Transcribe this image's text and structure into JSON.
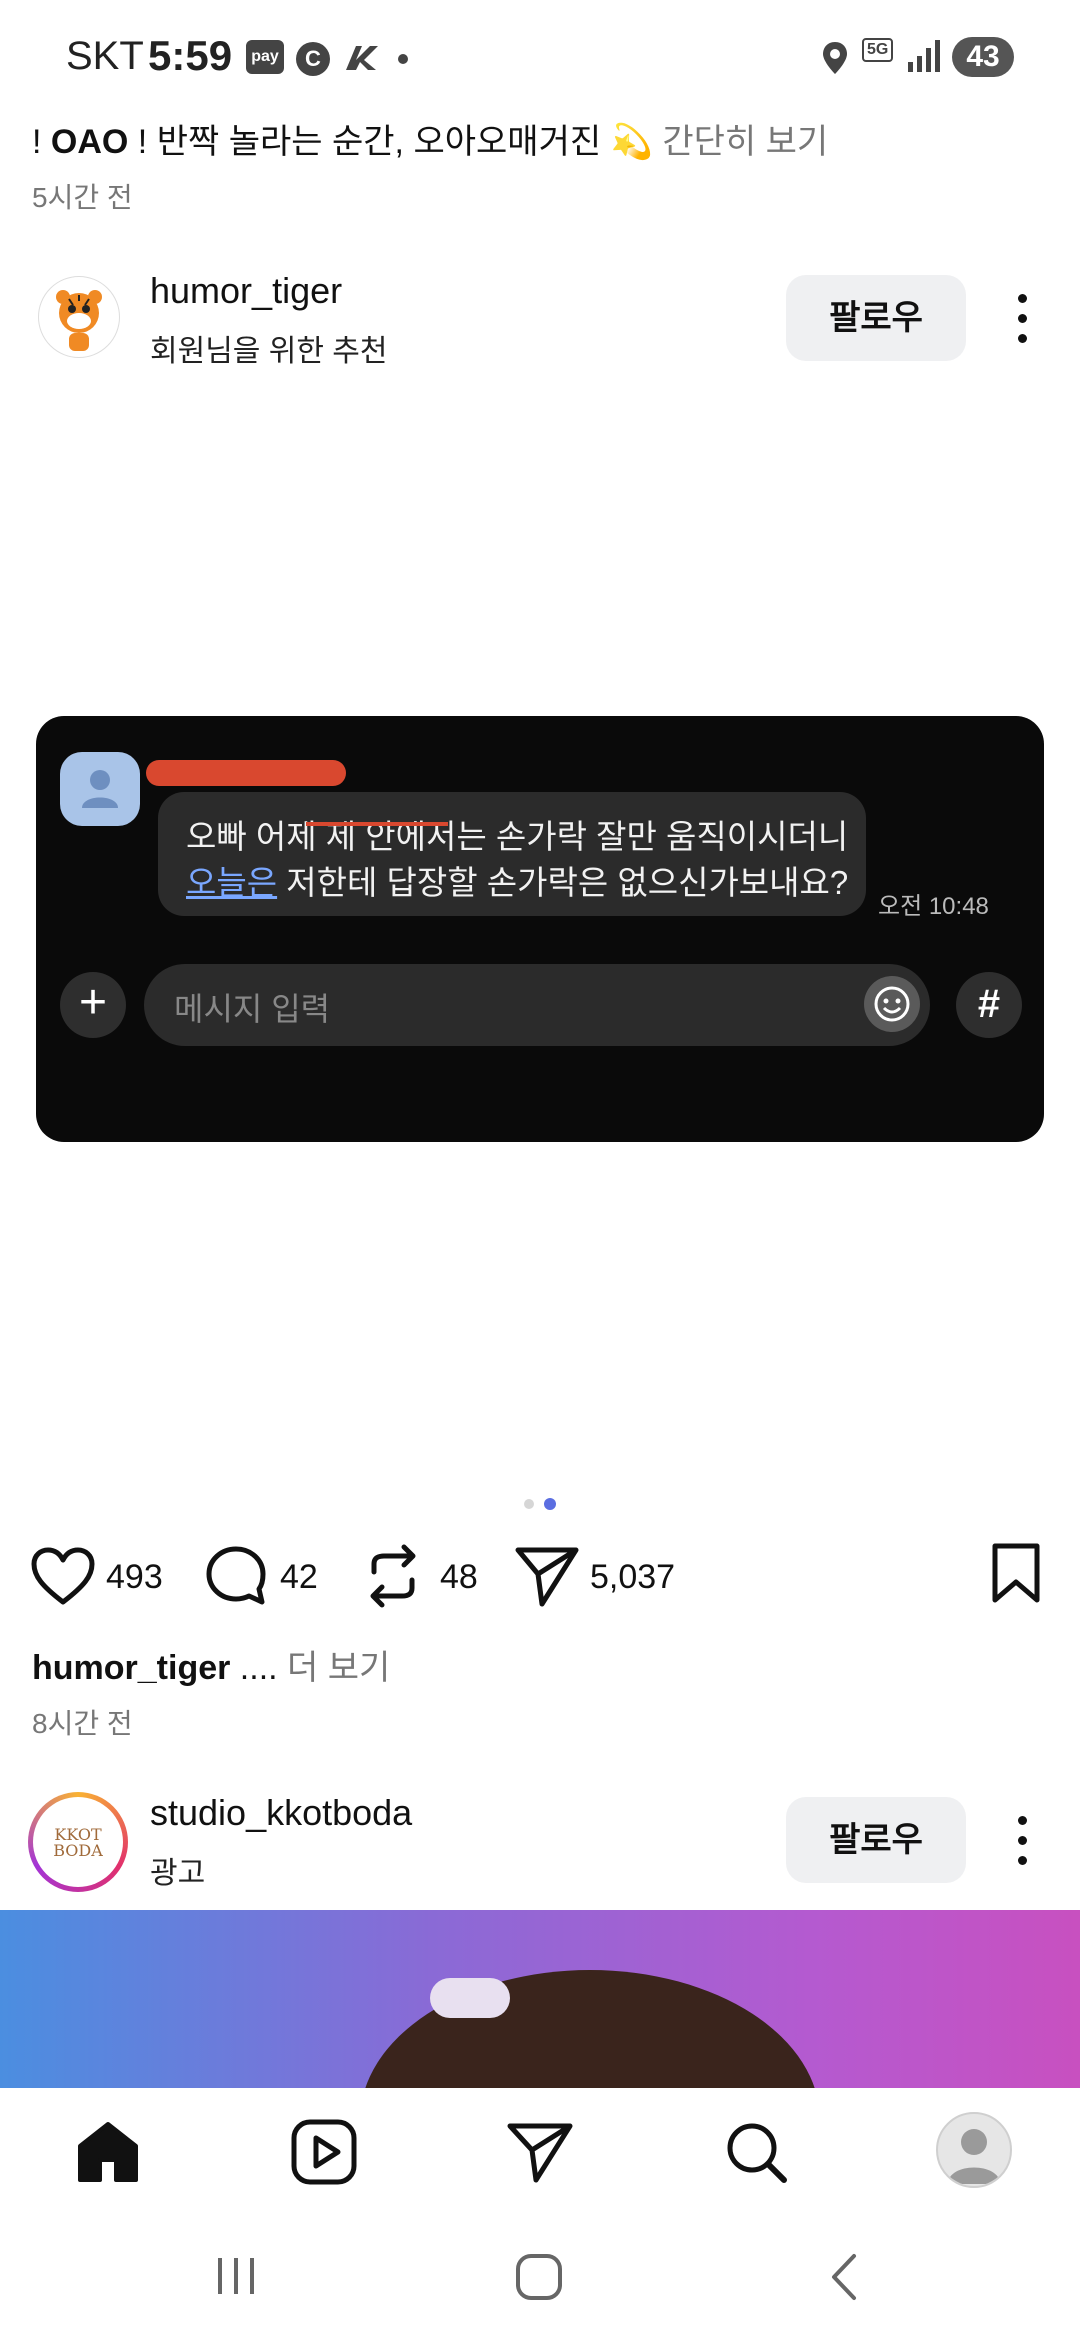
{
  "status_bar": {
    "carrier": "SKT",
    "time": "5:59",
    "pay_label": "pay",
    "c_label": "C",
    "network": "5G",
    "battery": "43"
  },
  "previous_post": {
    "caption_prefix": "! ",
    "caption_bold": "OAO",
    "caption_main": " ! 반짝 놀라는 순간, 오아오매거진 💫 ",
    "caption_more": "간단히 보기",
    "time": "5시간 전"
  },
  "post": {
    "username": "humor_tiger",
    "subtext": "회원님을 위한 추천",
    "follow_label": "팔로우",
    "chat_image": {
      "line1": "오빠 어제 제 안에서는 손가락 잘만 움직이시더니",
      "line2_link": "오늘은",
      "line2_rest": " 저한테 답장할 손가락은 없으신가보내요?",
      "time": "오전 10:48",
      "input_placeholder": "메시지 입력",
      "plus_label": "+",
      "hash_label": "#"
    },
    "actions": {
      "likes": "493",
      "comments": "42",
      "reposts": "48",
      "shares": "5,037"
    },
    "caption_user": "humor_tiger",
    "caption_dots": " ....",
    "caption_more": " 더 보기",
    "time": "8시간 전"
  },
  "ad_post": {
    "username": "studio_kkotboda",
    "subtext": "광고",
    "follow_label": "팔로우",
    "logo_text_1": "KKOT",
    "logo_text_2": "BODA"
  },
  "colors": {
    "accent_blue": "#5b6ee1",
    "link_blue": "#7aa7ff",
    "redact_red": "#d9482f",
    "follow_bg": "#eff0f2"
  },
  "icons": {
    "like": "heart-icon",
    "comment": "comment-icon",
    "repost": "repost-icon",
    "share": "send-icon",
    "bookmark": "bookmark-icon",
    "home": "home-icon",
    "reels": "play-icon",
    "dm": "send-icon",
    "search": "search-icon",
    "profile": "avatar-icon"
  },
  "carousel": {
    "count": 2,
    "active_index": 1
  }
}
